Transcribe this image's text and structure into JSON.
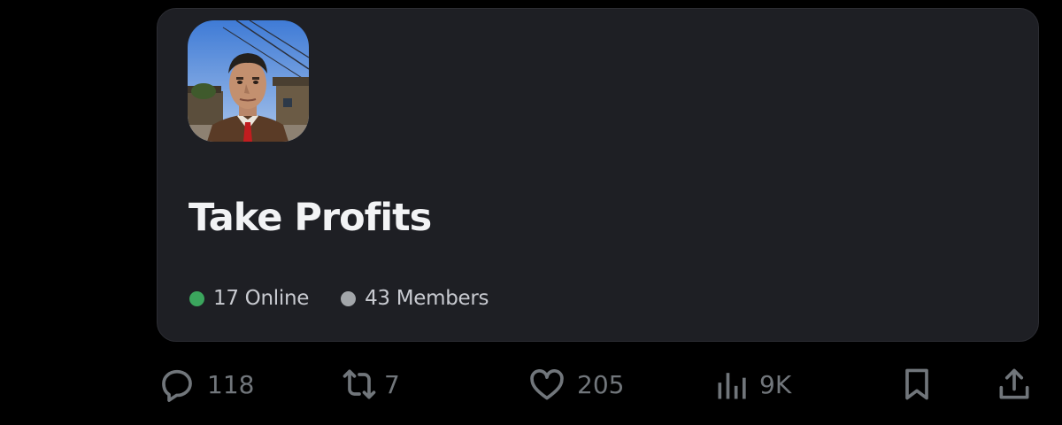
{
  "server_card": {
    "name": "Take Profits",
    "icon": "server-avatar-image",
    "stats": [
      {
        "label": "17 Online",
        "dot_color": "#3ba55d"
      },
      {
        "label": "43 Members",
        "dot_color": "#a3a6aa"
      }
    ]
  },
  "actions": {
    "reply": {
      "icon": "reply-icon",
      "count": "118"
    },
    "repost": {
      "icon": "repost-icon",
      "count": "7"
    },
    "like": {
      "icon": "heart-icon",
      "count": "205"
    },
    "views": {
      "icon": "views-icon",
      "count": "9K"
    },
    "bookmark": {
      "icon": "bookmark-icon"
    },
    "share": {
      "icon": "share-icon"
    }
  },
  "colors": {
    "page_background": "#000000",
    "card_background": "#1e1f24",
    "action_gray": "#71767b",
    "title_text": "#f2f3f5"
  }
}
